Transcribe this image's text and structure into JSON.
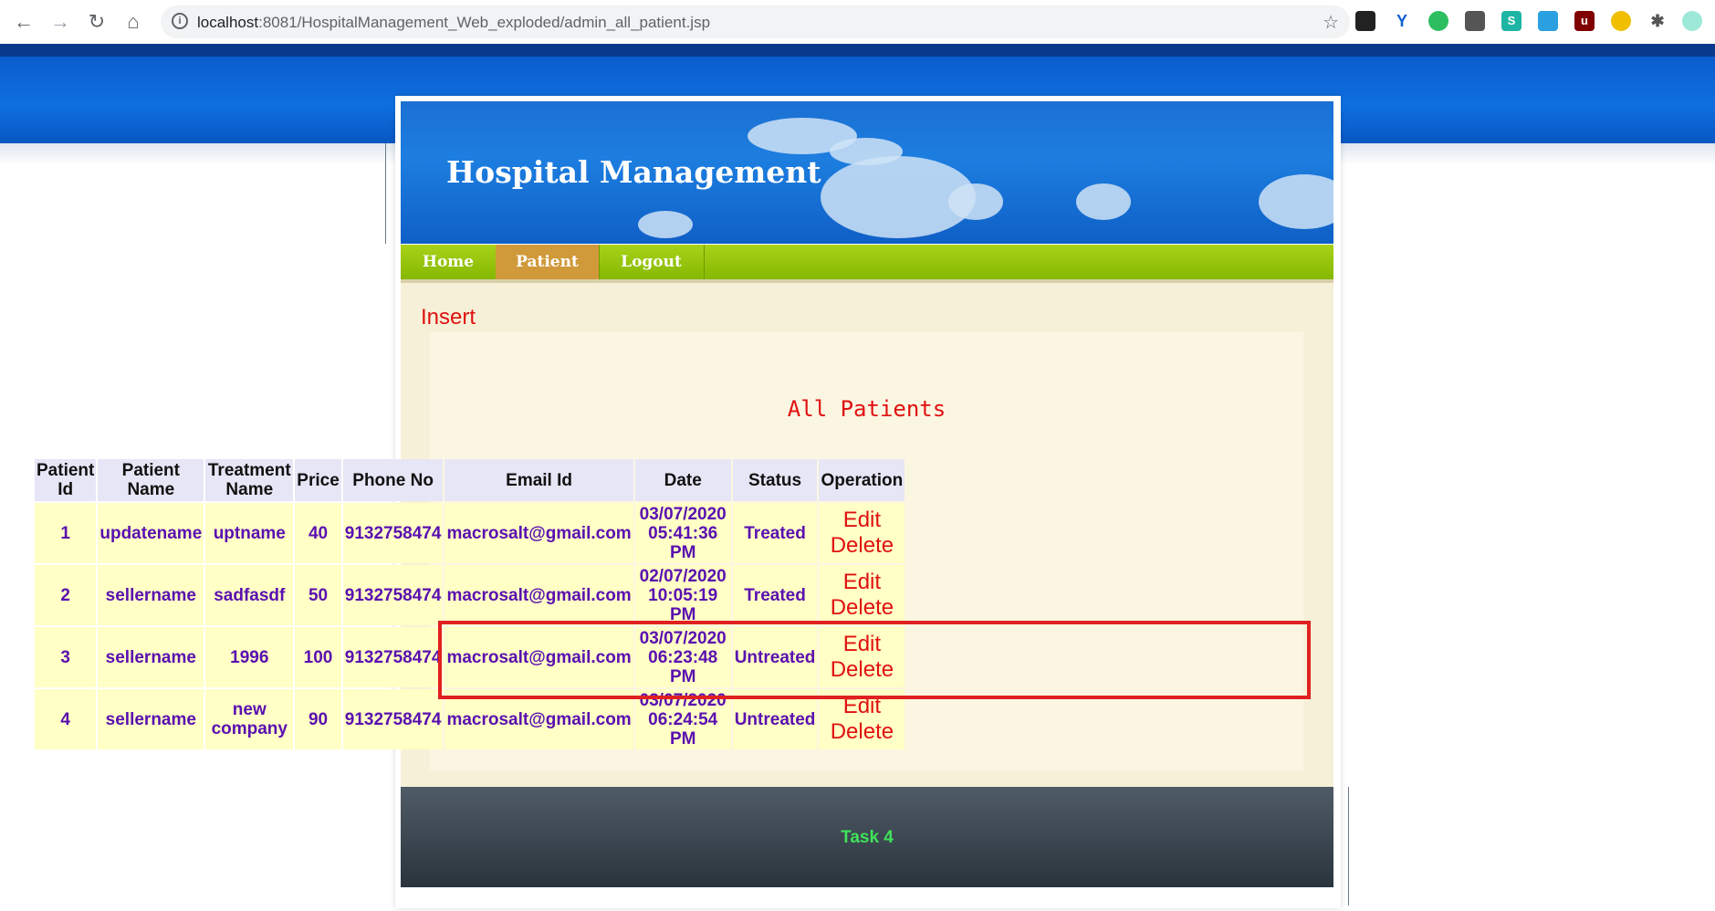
{
  "browser": {
    "url_host": "localhost",
    "url_path": ":8081/HospitalManagement_Web_exploded/admin_all_patient.jsp",
    "icons": [
      "back-icon",
      "forward-icon",
      "reload-icon",
      "home-icon",
      "info-icon",
      "star-icon",
      "extensions-icon",
      "profile-avatar"
    ]
  },
  "header": {
    "title": "Hospital Management"
  },
  "nav": {
    "items": [
      {
        "label": "Home"
      },
      {
        "label": "Patient"
      },
      {
        "label": "Logout"
      }
    ],
    "active": "Patient"
  },
  "content": {
    "insert_link": "Insert",
    "panel_title": "All Patients"
  },
  "table": {
    "headers": {
      "patient_id": "Patient Id",
      "patient_name": "Patient Name",
      "treatment_name": "Treatment Name",
      "price": "Price",
      "phone": "Phone No",
      "email": "Email Id",
      "date": "Date",
      "status": "Status",
      "operation": "Operation"
    },
    "rows": [
      {
        "id": "1",
        "name": "updatename",
        "treatment": "uptname",
        "price": "40",
        "phone": "9132758474",
        "email": "macrosalt@gmail.com",
        "date": "03/07/2020 05:41:36 PM",
        "status": "Treated",
        "edit": "Edit",
        "delete": "Delete"
      },
      {
        "id": "2",
        "name": "sellername",
        "treatment": "sadfasdf",
        "price": "50",
        "phone": "9132758474",
        "email": "macrosalt@gmail.com",
        "date": "02/07/2020 10:05:19 PM",
        "status": "Treated",
        "edit": "Edit",
        "delete": "Delete"
      },
      {
        "id": "3",
        "name": "sellername",
        "treatment": "1996",
        "price": "100",
        "phone": "9132758474",
        "email": "macrosalt@gmail.com",
        "date": "03/07/2020 06:23:48 PM",
        "status": "Untreated",
        "edit": "Edit",
        "delete": "Delete"
      },
      {
        "id": "4",
        "name": "sellername",
        "treatment": "new company",
        "price": "90",
        "phone": "9132758474",
        "email": "macrosalt@gmail.com",
        "date": "03/07/2020 06:24:54 PM",
        "status": "Untreated",
        "edit": "Edit",
        "delete": "Delete"
      }
    ]
  },
  "footer": {
    "text": "Task 4"
  },
  "colors": {
    "accent_red": "#e01010",
    "row_text": "#5a10b0",
    "nav_green": "#9ac810",
    "footer_text": "#3fe25a"
  }
}
